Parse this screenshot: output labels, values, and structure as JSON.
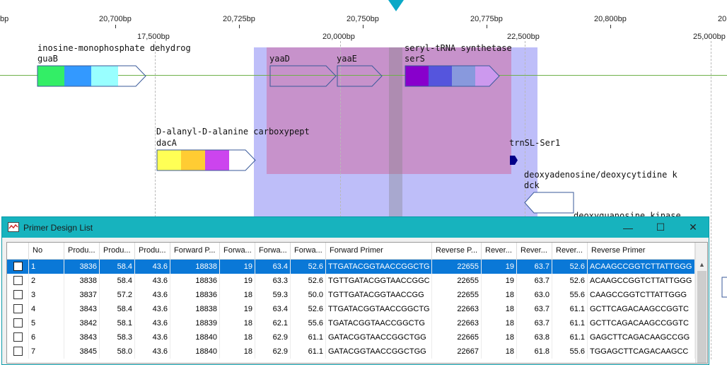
{
  "viewer": {
    "top_ruler": [
      "bp",
      "20,700bp",
      "20,725bp",
      "20,750bp",
      "20,775bp",
      "20,800bp",
      "20"
    ],
    "bottom_ruler": [
      "17,500bp",
      "20,000bp",
      "22,500bp",
      "25,000bp"
    ],
    "genes": [
      {
        "desc": "inosine-monophosphate dehydrog",
        "name": "guaB",
        "colors": [
          "#33ee66",
          "#3399ff",
          "#99ffff",
          "#ffffff"
        ]
      },
      {
        "desc": "",
        "name": "yaaD",
        "colors": []
      },
      {
        "desc": "",
        "name": "yaaE",
        "colors": []
      },
      {
        "desc": "seryl-tRNA synthetase",
        "name": "serS",
        "colors": [
          "#8800cc",
          "#5555dd",
          "#8899dd",
          "#cc99ee"
        ]
      },
      {
        "desc": "D-alanyl-D-alanine carboxypept",
        "name": "dacA",
        "colors": [
          "#ffff55",
          "#ffcc33",
          "#cc44ee",
          "#ffffff"
        ]
      },
      {
        "desc": "",
        "name": "trnSL-Ser1",
        "colors": [
          "#000088"
        ]
      },
      {
        "desc": "deoxyadenosine/deoxycytidine k",
        "name": "dck",
        "colors": [
          "#ffffff"
        ]
      },
      {
        "desc": "deoxyguanosine kinase",
        "name": "",
        "colors": []
      }
    ],
    "highlight_colors": {
      "outer": "#9696f5",
      "inner": "#cd78af",
      "band": "#808080",
      "marker": "#0aa9c7",
      "axis": "#6fb04a"
    }
  },
  "dialog": {
    "title": "Primer Design List",
    "buttons": {
      "minimize": "—",
      "maximize": "☐",
      "close": "✕"
    },
    "columns": [
      "",
      "No",
      "Produ...",
      "Produ...",
      "Produ...",
      "Forward P...",
      "Forwa...",
      "Forwa...",
      "Forwa...",
      "Forward Primer",
      "Reverse P...",
      "Rever...",
      "Rever...",
      "Rever...",
      "Reverse Primer"
    ],
    "rows": [
      [
        "1",
        "3836",
        "58.4",
        "43.6",
        "18838",
        "19",
        "63.4",
        "52.6",
        "TTGATACGGTAACCGGCTG",
        "22655",
        "19",
        "63.7",
        "52.6",
        "ACAAGCCGGTCTTATTGGG"
      ],
      [
        "2",
        "3838",
        "58.4",
        "43.6",
        "18836",
        "19",
        "63.3",
        "52.6",
        "TGTTGATACGGTAACCGGC",
        "22655",
        "19",
        "63.7",
        "52.6",
        "ACAAGCCGGTCTTATTGGG"
      ],
      [
        "3",
        "3837",
        "57.2",
        "43.6",
        "18836",
        "18",
        "59.3",
        "50.0",
        "TGTTGATACGGTAACCGG",
        "22655",
        "18",
        "63.0",
        "55.6",
        "CAAGCCGGTCTTATTGGG"
      ],
      [
        "4",
        "3843",
        "58.4",
        "43.6",
        "18838",
        "19",
        "63.4",
        "52.6",
        "TTGATACGGTAACCGGCTG",
        "22663",
        "18",
        "63.7",
        "61.1",
        "GCTTCAGACAAGCCGGTC"
      ],
      [
        "5",
        "3842",
        "58.1",
        "43.6",
        "18839",
        "18",
        "62.1",
        "55.6",
        "TGATACGGTAACCGGCTG",
        "22663",
        "18",
        "63.7",
        "61.1",
        "GCTTCAGACAAGCCGGTC"
      ],
      [
        "6",
        "3843",
        "58.3",
        "43.6",
        "18840",
        "18",
        "62.9",
        "61.1",
        "GATACGGTAACCGGCTGG",
        "22665",
        "18",
        "63.8",
        "61.1",
        "GAGCTTCAGACAAGCCGG"
      ],
      [
        "7",
        "3845",
        "58.0",
        "43.6",
        "18840",
        "18",
        "62.9",
        "61.1",
        "GATACGGTAACCGGCTGG",
        "22667",
        "18",
        "61.8",
        "55.6",
        "TGGAGCTTCAGACAAGCC"
      ]
    ],
    "selected_row": 0
  }
}
